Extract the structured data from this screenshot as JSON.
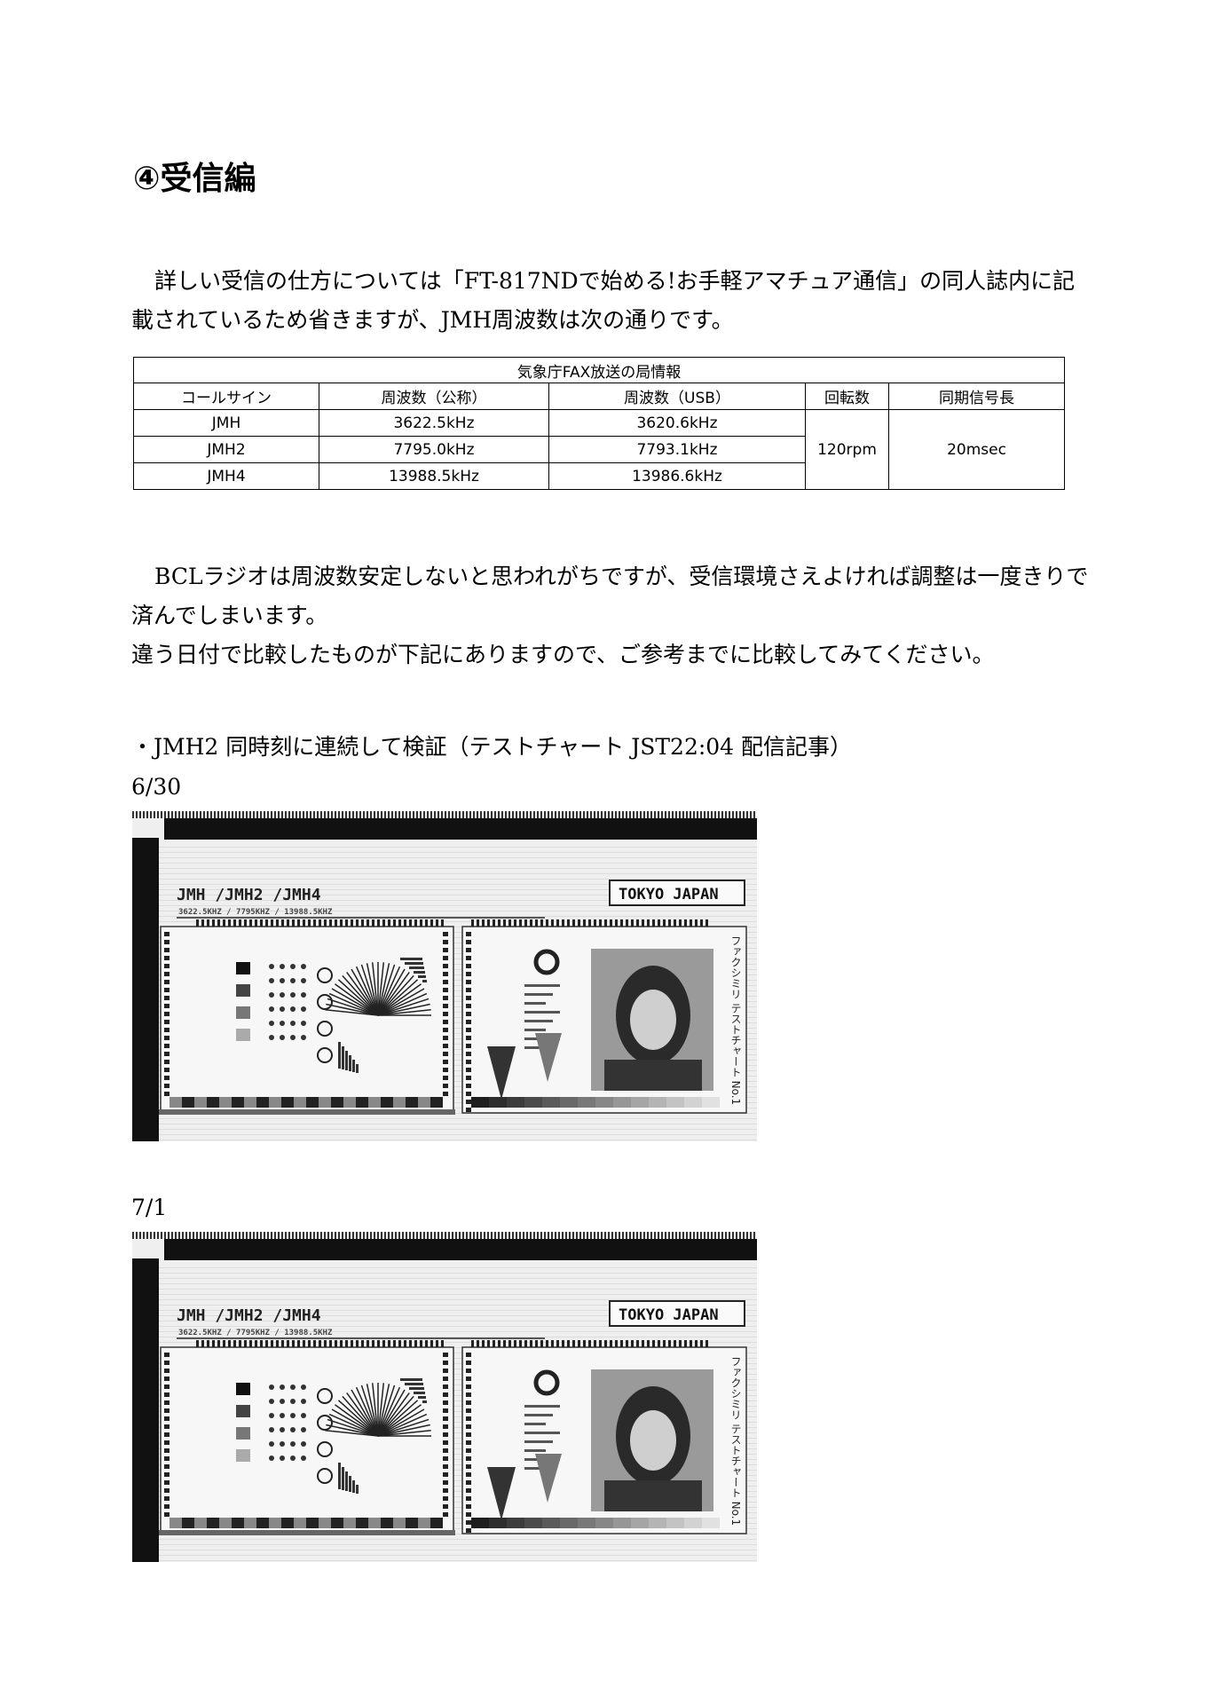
{
  "heading": "④受信編",
  "intro_paragraph": "詳しい受信の仕方については「FT-817NDで始める!お手軽アマチュア通信」の同人誌内に記載されているため省きますが、JMH周波数は次の通りです。",
  "table": {
    "caption": "気象庁FAX放送の局情報",
    "headers": [
      "コールサイン",
      "周波数（公称）",
      "周波数（USB）",
      "回転数",
      "同期信号長"
    ],
    "rows": [
      [
        "JMH",
        "3622.5kHz",
        "3620.6kHz"
      ],
      [
        "JMH2",
        "7795.0kHz",
        "7793.1kHz"
      ],
      [
        "JMH4",
        "13988.5kHz",
        "13986.6kHz"
      ]
    ],
    "rpm": "120rpm",
    "sync": "20msec"
  },
  "para2": "BCLラジオは周波数安定しないと思われがちですが、受信環境さえよければ調整は一度きりで済んでしまいます。",
  "para3": "違う日付で比較したものが下記にありますので、ご参考までに比較してみてください。",
  "bullet": "・JMH2 同時刻に連続して検証（テストチャート JST22:04 配信記事）",
  "fax_images": [
    {
      "date": "6/30",
      "stations": [
        "JMH",
        "/JMH2",
        "/JMH4"
      ],
      "freqs": "3622.5KHZ / 7795KHZ / 13988.5KHZ",
      "location": "TOKYO JAPAN",
      "side_text": "ファクシミリ テストチャート No.1"
    },
    {
      "date": "7/1",
      "stations": [
        "JMH",
        "/JMH2",
        "/JMH4"
      ],
      "freqs": "3622.5KHZ / 7795KHZ / 13988.5KHZ",
      "location": "TOKYO JAPAN",
      "side_text": "ファクシミリ テストチャート No.1"
    }
  ]
}
